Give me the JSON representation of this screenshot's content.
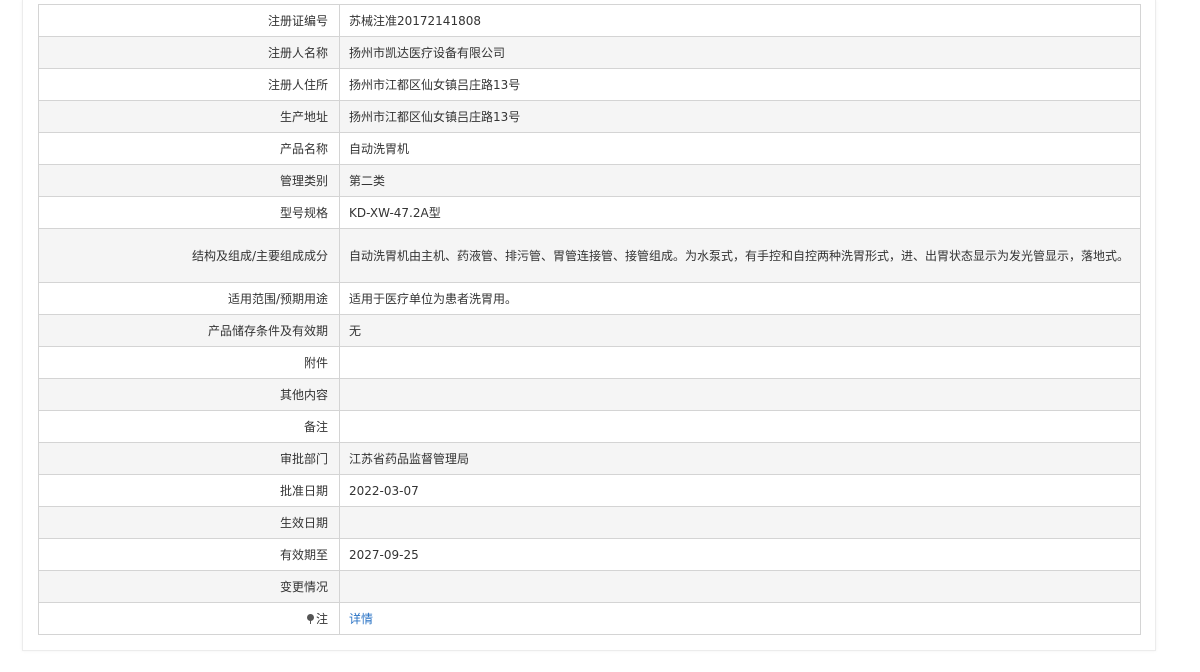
{
  "rows": [
    {
      "label": "注册证编号",
      "value": "苏械注准20172141808"
    },
    {
      "label": "注册人名称",
      "value": "扬州市凯达医疗设备有限公司"
    },
    {
      "label": "注册人住所",
      "value": "扬州市江都区仙女镇吕庄路13号"
    },
    {
      "label": "生产地址",
      "value": "扬州市江都区仙女镇吕庄路13号"
    },
    {
      "label": "产品名称",
      "value": "自动洗胃机"
    },
    {
      "label": "管理类别",
      "value": "第二类"
    },
    {
      "label": "型号规格",
      "value": "KD-XW-47.2A型"
    },
    {
      "label": "结构及组成/主要组成成分",
      "value": "自动洗胃机由主机、药液管、排污管、胃管连接管、接管组成。为水泵式，有手控和自控两种洗胃形式，进、出胃状态显示为发光管显示，落地式。"
    },
    {
      "label": "适用范围/预期用途",
      "value": "适用于医疗单位为患者洗胃用。"
    },
    {
      "label": "产品储存条件及有效期",
      "value": "无"
    },
    {
      "label": "附件",
      "value": ""
    },
    {
      "label": "其他内容",
      "value": ""
    },
    {
      "label": "备注",
      "value": ""
    },
    {
      "label": "审批部门",
      "value": "江苏省药品监督管理局"
    },
    {
      "label": "批准日期",
      "value": "2022-03-07"
    },
    {
      "label": "生效日期",
      "value": ""
    },
    {
      "label": "有效期至",
      "value": "2027-09-25"
    },
    {
      "label": "变更情况",
      "value": ""
    }
  ],
  "note_row": {
    "icon": "pin-icon",
    "label": "注",
    "link_text": "详情"
  },
  "colors": {
    "link": "#2a73c5",
    "row_alt": "#f5f5f5",
    "border": "#d4d4d4"
  }
}
